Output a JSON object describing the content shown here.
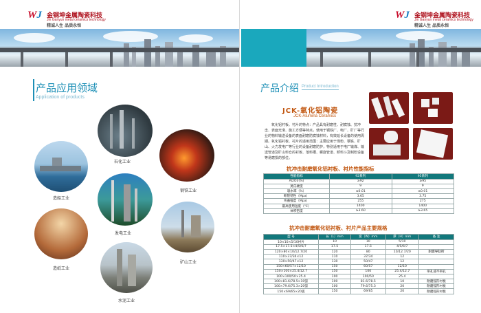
{
  "logo": {
    "mark": "WJ",
    "company_cn": "金钢坤金属陶瓷科技",
    "company_en": "Jin Ganyun metal ceramics technology",
    "slogan": "精诚人生 品质永恒"
  },
  "left_page": {
    "section_title": "产品应用领域",
    "section_title_en": "Application of products",
    "applications": [
      {
        "label": "石化工业"
      },
      {
        "label": "钢铁工业"
      },
      {
        "label": "造船工业"
      },
      {
        "label": "发电工业"
      },
      {
        "label": "造纸工业"
      },
      {
        "label": "矿山工业"
      },
      {
        "label": "水泥工业"
      }
    ]
  },
  "right_page": {
    "section_title": "产品介绍",
    "section_title_en": "Product Introduction",
    "product_title": "JCK-氧化铝陶瓷",
    "product_subtitle": "JCK-Alumina Ceramics",
    "description": "氧化铝衬板、衬片的特点：产品具有耐磨性、耐腐蚀、抗冲击、表面光滑、施工方便等特点，使用于钢铁厂、电厂、矿厂等行业的物料输送设备的表面耐磨防腐蚀材料，有效延长设备的使用周期。氧化铝衬板、衬片的适用范围：主要应用于煤粉、钢铁、矿山、火力发电厂等行业的设备耐磨防护，特别适用于电厂输煤、输送管道及矿山料仓的衬板、落料槽、螺旋管道、卸料斗及制粉设备等易磨损的部位。",
    "table1": {
      "title": "抗冲击耐磨氧化铝衬板、衬片性能指标",
      "headers": [
        "性能指标",
        "92系列",
        "95系列"
      ],
      "rows": [
        [
          "Al2O3(%)",
          "≥92",
          "≥95"
        ],
        [
          "莫氏硬度",
          "9",
          "9"
        ],
        [
          "吸水率（%）",
          "≤0.01",
          "≤0.01"
        ],
        [
          "断裂韧性（Mpa）",
          "3.65",
          "3.75"
        ],
        [
          "弯曲强度（Mpa）",
          "255",
          "275"
        ],
        [
          "最高使用温度（℃）",
          "1400",
          "1400"
        ],
        [
          "体积密度",
          "≥3.60",
          "≥3.65"
        ]
      ]
    },
    "table2": {
      "title": "抗冲击耐磨氧化铝衬板、衬片产品主要规格",
      "headers": [
        "型  号",
        "长（L）mm",
        "宽（W）mm",
        "厚（H）mm",
        "备  注"
      ],
      "rows": [
        [
          "10×10×5/10衬片",
          "10",
          "10",
          "5/10",
          ""
        ],
        [
          "17.5×17.5×4/5/6/7",
          "17.5",
          "17.5",
          "4/5/6/7",
          ""
        ],
        [
          "120×80×10/12.7/20",
          "120",
          "80",
          "10/12.7/20",
          "耐磨导轨砖"
        ],
        [
          "110×37/34×12",
          "110",
          "37/34",
          "12",
          ""
        ],
        [
          "130×50/47×12",
          "130",
          "50/47",
          "12",
          ""
        ],
        [
          "150×60/57×12/10",
          "150",
          "60/57",
          "12/10",
          ""
        ],
        [
          "150×100×25.4/12.7",
          "150",
          "100",
          "25.4/12.7",
          "带孔或不带孔"
        ],
        [
          "100×100/50×25.4",
          "100",
          "100/50",
          "25.4",
          ""
        ],
        [
          "100×81.6/78.5×10弧",
          "100",
          "81.6/78.5",
          "10",
          "耐磨弧形衬板"
        ],
        [
          "100×79.6/75.3×20弧",
          "100",
          "79.6/75.3",
          "20",
          "耐磨弧形衬板"
        ],
        [
          "150×69/65×20弧",
          "150",
          "69/65",
          "20",
          "耐磨弧形衬板"
        ]
      ]
    }
  },
  "colors": {
    "accent_blue": "#1c8fb6",
    "title_orange": "#c1560f",
    "table_header": "#12787c",
    "banner_teal": "#1aa8bd"
  }
}
